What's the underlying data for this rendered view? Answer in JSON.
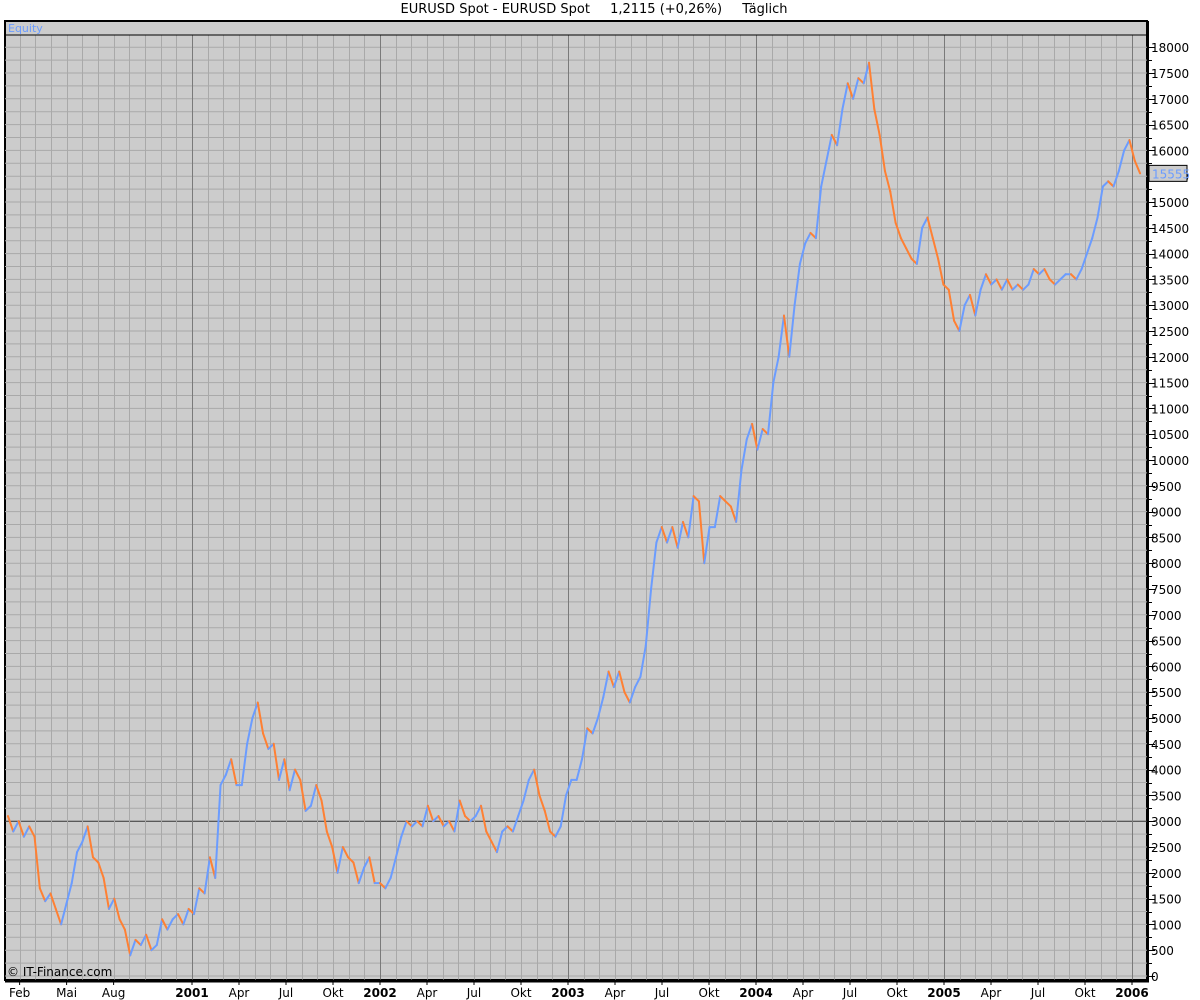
{
  "header": {
    "instrument": "EURUSD Spot - EURUSD Spot",
    "price": "1,2115 (+0,26%)",
    "period": "Täglich"
  },
  "chart_data": {
    "type": "line",
    "title": "EURUSD Spot - EURUSD Spot",
    "panel_label": "Equity",
    "watermark": "© IT-Finance.com",
    "last_value_label": "15555",
    "last_value": 15555,
    "ylim": [
      0,
      18300
    ],
    "xlim": [
      2000.0,
      2006.08
    ],
    "x_start": 2000.021,
    "x_end": 2006.043,
    "reference_line": 3000,
    "grid": true,
    "colors": {
      "up": "#6b9cff",
      "down": "#ff8033",
      "background": "#cccccc",
      "grid": "#a9a9a9",
      "year_grid": "#7a7a7a"
    },
    "y_ticks": [
      0,
      500,
      1000,
      1500,
      2000,
      2500,
      3000,
      3500,
      4000,
      4500,
      5000,
      5500,
      6000,
      6500,
      7000,
      7500,
      8000,
      8500,
      9000,
      9500,
      10000,
      10500,
      11000,
      11500,
      12000,
      12500,
      13000,
      13500,
      14000,
      14500,
      15000,
      15500,
      16000,
      16500,
      17000,
      17500,
      18000
    ],
    "x_ticks": [
      {
        "label": "Feb",
        "t": 2000.083,
        "bold": false
      },
      {
        "label": "Mai",
        "t": 2000.333,
        "bold": false
      },
      {
        "label": "Aug",
        "t": 2000.583,
        "bold": false
      },
      {
        "label": "2001",
        "t": 2001.0,
        "bold": true
      },
      {
        "label": "Apr",
        "t": 2001.25,
        "bold": false
      },
      {
        "label": "Jul",
        "t": 2001.5,
        "bold": false
      },
      {
        "label": "Okt",
        "t": 2001.75,
        "bold": false
      },
      {
        "label": "2002",
        "t": 2002.0,
        "bold": true
      },
      {
        "label": "Apr",
        "t": 2002.25,
        "bold": false
      },
      {
        "label": "Jul",
        "t": 2002.5,
        "bold": false
      },
      {
        "label": "Okt",
        "t": 2002.75,
        "bold": false
      },
      {
        "label": "2003",
        "t": 2003.0,
        "bold": true
      },
      {
        "label": "Apr",
        "t": 2003.25,
        "bold": false
      },
      {
        "label": "Jul",
        "t": 2003.5,
        "bold": false
      },
      {
        "label": "Okt",
        "t": 2003.75,
        "bold": false
      },
      {
        "label": "2004",
        "t": 2004.0,
        "bold": true
      },
      {
        "label": "Apr",
        "t": 2004.25,
        "bold": false
      },
      {
        "label": "Jul",
        "t": 2004.5,
        "bold": false
      },
      {
        "label": "Okt",
        "t": 2004.75,
        "bold": false
      },
      {
        "label": "2005",
        "t": 2005.0,
        "bold": true
      },
      {
        "label": "Apr",
        "t": 2005.25,
        "bold": false
      },
      {
        "label": "Jul",
        "t": 2005.5,
        "bold": false
      },
      {
        "label": "Okt",
        "t": 2005.75,
        "bold": false
      },
      {
        "label": "2006",
        "t": 2006.0,
        "bold": true
      }
    ],
    "series": [
      {
        "name": "Equity",
        "values": [
          3100,
          2800,
          3000,
          2700,
          2900,
          2700,
          1700,
          1450,
          1600,
          1300,
          1000,
          1400,
          1800,
          2400,
          2600,
          2900,
          2300,
          2200,
          1900,
          1300,
          1500,
          1100,
          900,
          400,
          700,
          600,
          800,
          500,
          600,
          1100,
          900,
          1100,
          1200,
          1000,
          1300,
          1200,
          1700,
          1600,
          2300,
          1900,
          3700,
          3900,
          4200,
          3700,
          3700,
          4500,
          5000,
          5300,
          4700,
          4400,
          4500,
          3800,
          4200,
          3600,
          4000,
          3800,
          3200,
          3300,
          3700,
          3400,
          2800,
          2500,
          2000,
          2500,
          2300,
          2200,
          1800,
          2100,
          2300,
          1800,
          1800,
          1700,
          1900,
          2300,
          2700,
          3000,
          2900,
          3000,
          2900,
          3300,
          3000,
          3100,
          2900,
          3000,
          2800,
          3400,
          3100,
          3000,
          3100,
          3300,
          2800,
          2600,
          2400,
          2800,
          2900,
          2800,
          3100,
          3400,
          3800,
          4000,
          3500,
          3200,
          2800,
          2700,
          2900,
          3500,
          3800,
          3800,
          4200,
          4800,
          4700,
          5000,
          5400,
          5900,
          5600,
          5900,
          5500,
          5300,
          5600,
          5800,
          6400,
          7500,
          8400,
          8700,
          8400,
          8700,
          8300,
          8800,
          8500,
          9300,
          9200,
          8000,
          8700,
          8700,
          9300,
          9200,
          9100,
          8800,
          9800,
          10400,
          10700,
          10200,
          10600,
          10500,
          11500,
          12000,
          12800,
          12000,
          13000,
          13800,
          14200,
          14400,
          14300,
          15300,
          15800,
          16300,
          16100,
          16800,
          17300,
          17000,
          17400,
          17300,
          17700,
          16800,
          16300,
          15600,
          15200,
          14600,
          14300,
          14100,
          13900,
          13800,
          14500,
          14700,
          14300,
          13900,
          13400,
          13300,
          12700,
          12500,
          13000,
          13200,
          12800,
          13300,
          13600,
          13400,
          13500,
          13300,
          13500,
          13300,
          13400,
          13300,
          13400,
          13700,
          13600,
          13700,
          13500,
          13400,
          13500,
          13600,
          13600,
          13500,
          13700,
          14000,
          14300,
          14700,
          15300,
          15400,
          15300,
          15600,
          16000,
          16200,
          15800,
          15555
        ]
      }
    ]
  }
}
